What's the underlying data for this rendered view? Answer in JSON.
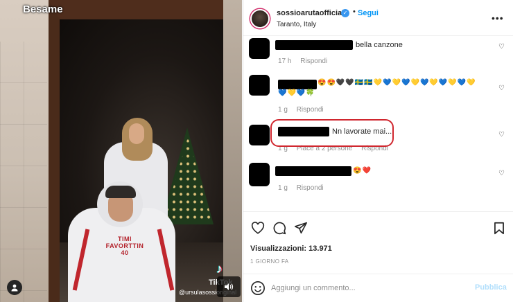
{
  "video": {
    "song_title": "Besame",
    "hoodie_print": "TIMI FAVORTTIN 40",
    "tiktok_logo": "♪",
    "tiktok_word": "TikTok",
    "tiktok_handle": "@ursulasossioriginal"
  },
  "header": {
    "username": "sossioarutaofficial",
    "follow_label": "Segui",
    "location": "Taranto, Italy",
    "more_label": "•••"
  },
  "comments": [
    {
      "text": "bella canzone",
      "time": "17 h",
      "reply": "Rispondi"
    },
    {
      "emojis_line1": "😍😍🖤🖤🇸🇪🇸🇪💛💙💛💙💛💙💛💙💛💙💛",
      "emojis_line2": "💙💛💙🍀",
      "time": "1 g",
      "reply": "Rispondi"
    },
    {
      "text": "Nn lavorate mai...",
      "time": "1 g",
      "likes": "Piace a 2 persone",
      "reply": "Rispondi"
    },
    {
      "emojis": "😍❤️",
      "time": "1 g",
      "reply": "Rispondi"
    }
  ],
  "actions": {
    "views": "Visualizzazioni: 13.971",
    "date": "1 GIORNO FA"
  },
  "composer": {
    "placeholder": "Aggiungi un commento...",
    "publish_label": "Pubblica"
  },
  "colors": {
    "accent": "#0095f6",
    "highlight": "#d0262e",
    "publish_disabled": "#b2dffc"
  }
}
